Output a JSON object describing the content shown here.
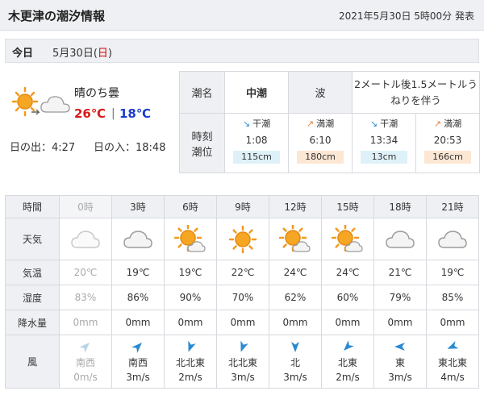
{
  "header": {
    "title": "木更津の潮汐情報",
    "announced": "2021年5月30日 5時00分 発表"
  },
  "day": {
    "label": "今日",
    "date": "5月30日",
    "weekday_open": "(",
    "weekday": "日",
    "weekday_close": ")"
  },
  "summary": {
    "condition": "晴のち曇",
    "high": "26℃",
    "separator": "|",
    "low": "18℃",
    "sunrise": "日の出：4:27",
    "sunset": "日の入：18:48",
    "icon": "sun-then-cloud-icon"
  },
  "tide": {
    "name_label": "潮名",
    "name_value": "中潮",
    "wave_label": "波",
    "wave_value": "2メートル後1.5メートルうねりを伴う",
    "time_label_1": "時刻",
    "time_label_2": "潮位",
    "events": [
      {
        "type": "low",
        "name": "干潮",
        "time": "1:08",
        "level": "115cm"
      },
      {
        "type": "high",
        "name": "満潮",
        "time": "6:10",
        "level": "180cm"
      },
      {
        "type": "low",
        "name": "干潮",
        "time": "13:34",
        "level": "13cm"
      },
      {
        "type": "high",
        "name": "満潮",
        "time": "20:53",
        "level": "166cm"
      }
    ]
  },
  "forecast": {
    "labels": {
      "time": "時間",
      "weather": "天気",
      "temp": "気温",
      "humidity": "湿度",
      "precip": "降水量",
      "wind": "風"
    },
    "hours": [
      {
        "hour": "0時",
        "past": true,
        "weather": "cloud",
        "temp": "20℃",
        "humidity": "83%",
        "precip": "0mm",
        "wind_dir": "南西",
        "wind_speed": "0m/s",
        "wind_rot": 45
      },
      {
        "hour": "3時",
        "past": false,
        "weather": "cloud",
        "temp": "19℃",
        "humidity": "86%",
        "precip": "0mm",
        "wind_dir": "南西",
        "wind_speed": "3m/s",
        "wind_rot": 45
      },
      {
        "hour": "6時",
        "past": false,
        "weather": "sun-cloud",
        "temp": "19℃",
        "humidity": "90%",
        "precip": "0mm",
        "wind_dir": "北北東",
        "wind_speed": "2m/s",
        "wind_rot": 200
      },
      {
        "hour": "9時",
        "past": false,
        "weather": "sun",
        "temp": "22℃",
        "humidity": "70%",
        "precip": "0mm",
        "wind_dir": "北北東",
        "wind_speed": "3m/s",
        "wind_rot": 200
      },
      {
        "hour": "12時",
        "past": false,
        "weather": "sun-cloud",
        "temp": "24℃",
        "humidity": "62%",
        "precip": "0mm",
        "wind_dir": "北",
        "wind_speed": "3m/s",
        "wind_rot": 180
      },
      {
        "hour": "15時",
        "past": false,
        "weather": "sun-cloud",
        "temp": "24℃",
        "humidity": "60%",
        "precip": "0mm",
        "wind_dir": "北東",
        "wind_speed": "2m/s",
        "wind_rot": 225
      },
      {
        "hour": "18時",
        "past": false,
        "weather": "cloud",
        "temp": "21℃",
        "humidity": "79%",
        "precip": "0mm",
        "wind_dir": "東",
        "wind_speed": "3m/s",
        "wind_rot": 270
      },
      {
        "hour": "21時",
        "past": false,
        "weather": "cloud",
        "temp": "19℃",
        "humidity": "85%",
        "precip": "0mm",
        "wind_dir": "東北東",
        "wind_speed": "4m/s",
        "wind_rot": 247
      }
    ]
  },
  "colors": {
    "high_temp": "#d61a1a",
    "low_temp": "#1a3ccf",
    "sunday": "#d00000",
    "sun": "#f29a1f",
    "wind_arrow": "#2a8ad0"
  }
}
